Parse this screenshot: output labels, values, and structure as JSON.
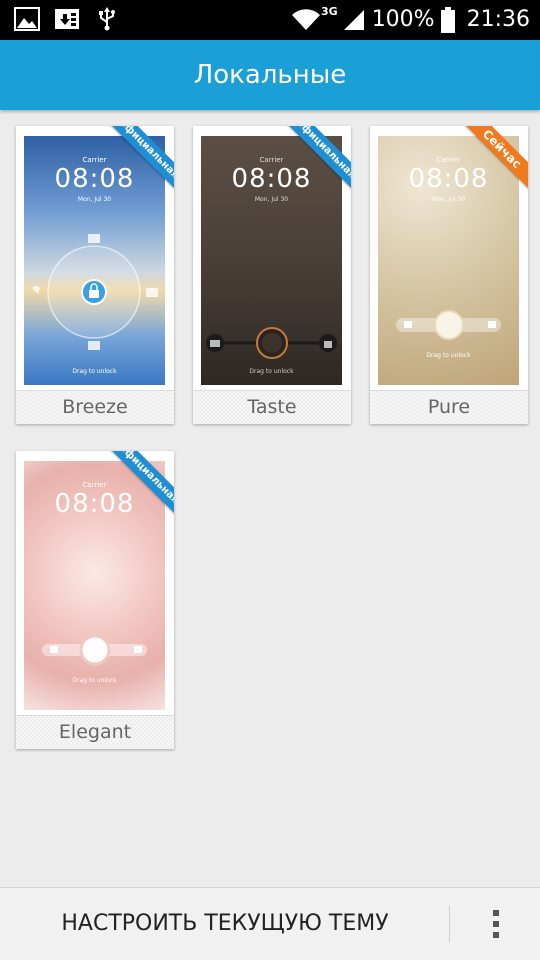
{
  "status_bar": {
    "network": "3G",
    "battery": "100%",
    "time": "21:36"
  },
  "header": {
    "title": "Локальные"
  },
  "themes": [
    {
      "name": "Breeze",
      "badge": "Официальная",
      "badge_color": "#1e8fd5",
      "carrier": "Carrier",
      "time": "08:08",
      "date": "Mon, Jul 30",
      "hint": "Drag to unlock"
    },
    {
      "name": "Taste",
      "badge": "Официальная",
      "badge_color": "#1e8fd5",
      "carrier": "Carrier",
      "time": "08:08",
      "date": "Mon, Jul 30",
      "hint": "Drag to unlock"
    },
    {
      "name": "Pure",
      "badge": "Сейчас",
      "badge_color": "#f07a1c",
      "carrier": "Carrier",
      "time": "08:08",
      "date": "Mon, Jul 30",
      "hint": "Drag to unlock"
    },
    {
      "name": "Elegant",
      "badge": "Официальная",
      "badge_color": "#1e8fd5",
      "carrier": "Carrier",
      "time": "08:08",
      "date": "",
      "hint": "Drag to unlock"
    }
  ],
  "bottom_bar": {
    "action_label": "НАСТРОИТЬ ТЕКУЩУЮ ТЕМУ",
    "menu_icon": "overflow-menu-icon"
  },
  "colors": {
    "header": "#1a9fd6",
    "official_badge": "#1e8fd5",
    "current_badge": "#f07a1c"
  }
}
